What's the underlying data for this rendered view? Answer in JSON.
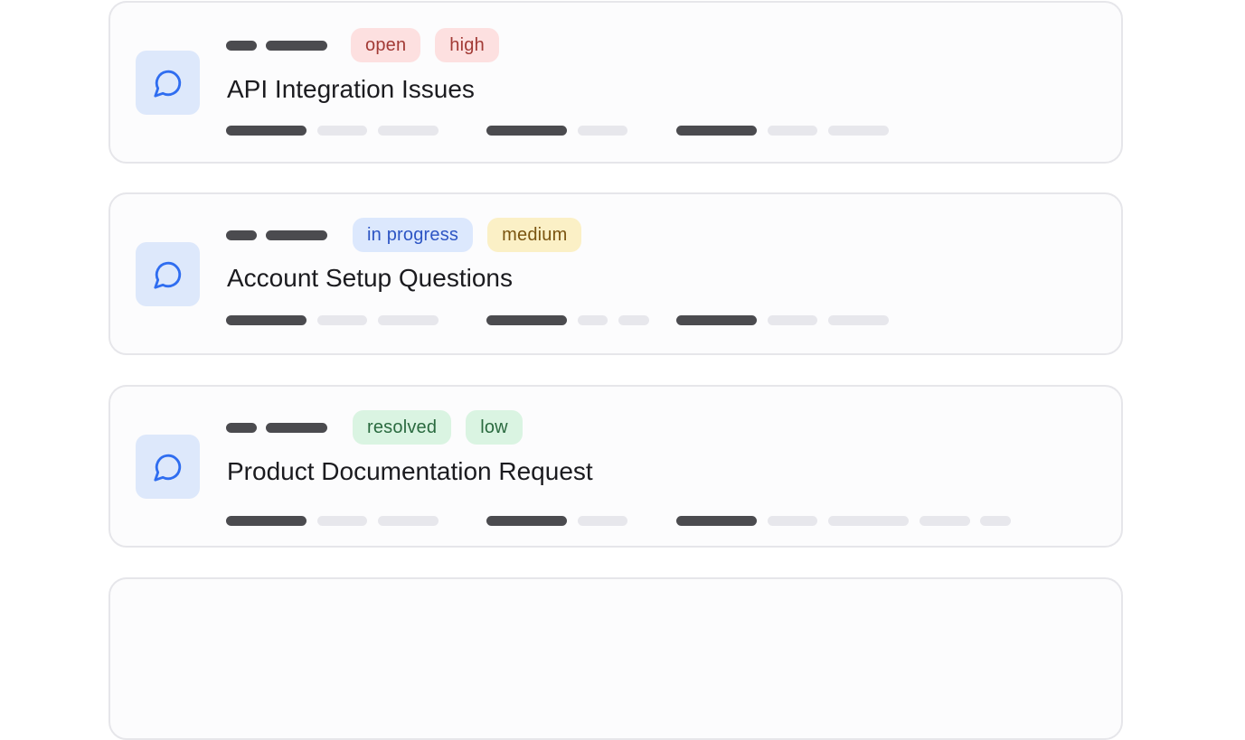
{
  "icons": {
    "card_icon": "message-circle-icon"
  },
  "colors": {
    "icon_tile_bg": "#dde8fb",
    "icon_stroke": "#2f6df0"
  },
  "tickets": [
    {
      "title": "API Integration Issues",
      "status": {
        "label": "open",
        "bg": "#fde0e0",
        "fg": "#a23a35"
      },
      "priority": {
        "label": "high",
        "bg": "#fde0e0",
        "fg": "#a23a35"
      }
    },
    {
      "title": "Account Setup Questions",
      "status": {
        "label": "in progress",
        "bg": "#dce8fd",
        "fg": "#2d55c4"
      },
      "priority": {
        "label": "medium",
        "bg": "#fbf0c6",
        "fg": "#7a5410"
      }
    },
    {
      "title": "Product Documentation Request",
      "status": {
        "label": "resolved",
        "bg": "#daf4e2",
        "fg": "#2a6a3f"
      },
      "priority": {
        "label": "low",
        "bg": "#daf4e2",
        "fg": "#2a6a3f"
      }
    },
    {
      "title": "",
      "status": {
        "label": "",
        "bg": "",
        "fg": ""
      },
      "priority": {
        "label": "",
        "bg": "",
        "fg": ""
      }
    }
  ]
}
